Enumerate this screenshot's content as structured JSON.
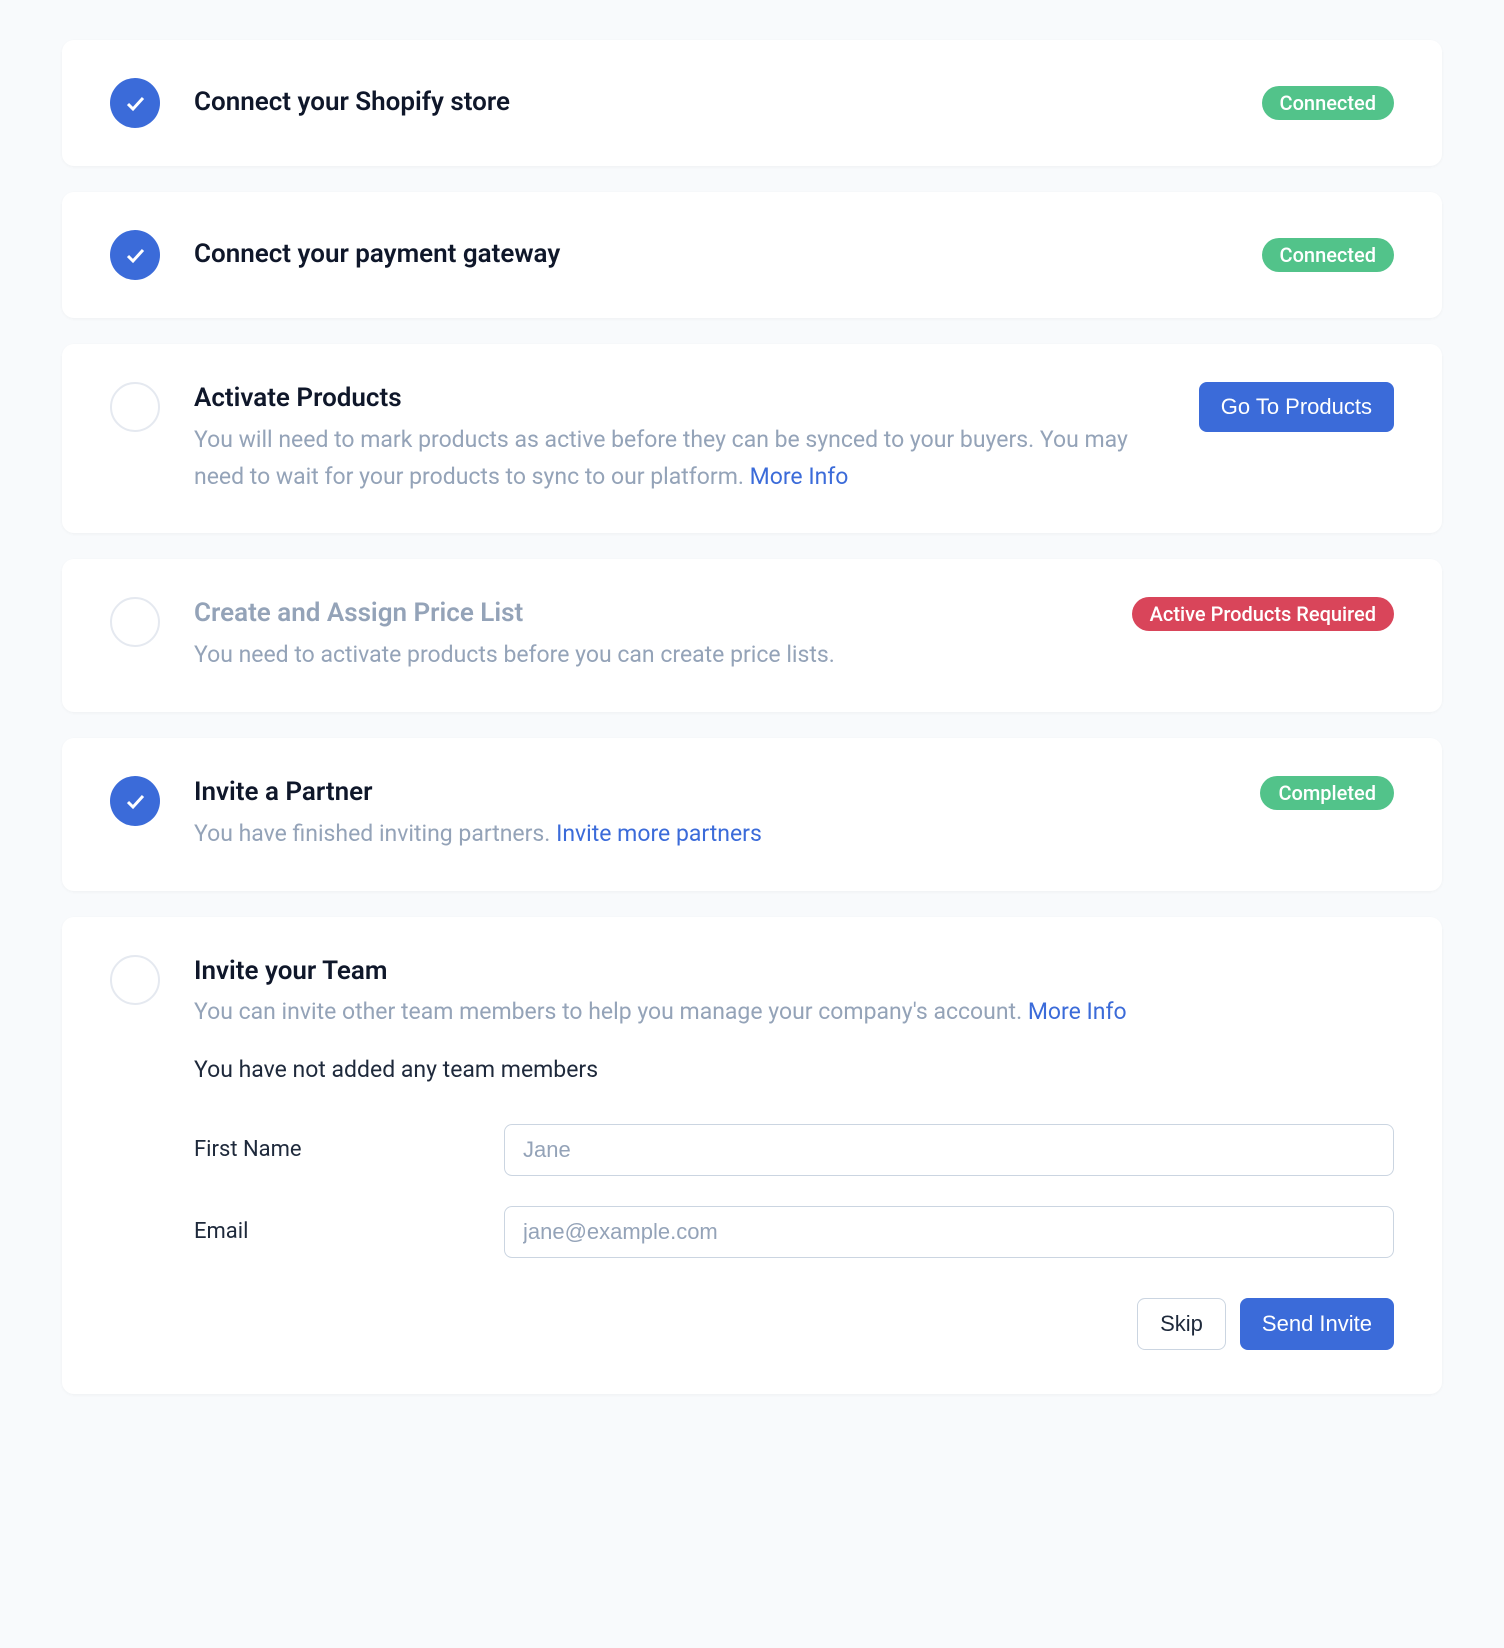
{
  "steps": {
    "shopify": {
      "title": "Connect your Shopify store",
      "badge": "Connected"
    },
    "payment": {
      "title": "Connect your payment gateway",
      "badge": "Connected"
    },
    "products": {
      "title": "Activate Products",
      "desc": "You will need to mark products as active before they can be synced to your buyers. You may need to wait for your products to sync to our platform. ",
      "more_info": "More Info",
      "button": "Go To Products"
    },
    "pricelist": {
      "title": "Create and Assign Price List",
      "desc": "You need to activate products before you can create price lists.",
      "badge": "Active Products Required"
    },
    "partner": {
      "title": "Invite a Partner",
      "desc": "You have finished inviting partners. ",
      "link": "Invite more partners",
      "badge": "Completed"
    },
    "team": {
      "title": "Invite your Team",
      "desc": "You can invite other team members to help you manage your company's account. ",
      "more_info": "More Info",
      "empty_note": "You have not added any team members",
      "first_name_label": "First Name",
      "first_name_placeholder": "Jane",
      "email_label": "Email",
      "email_placeholder": "jane@example.com",
      "skip": "Skip",
      "send": "Send Invite"
    }
  }
}
